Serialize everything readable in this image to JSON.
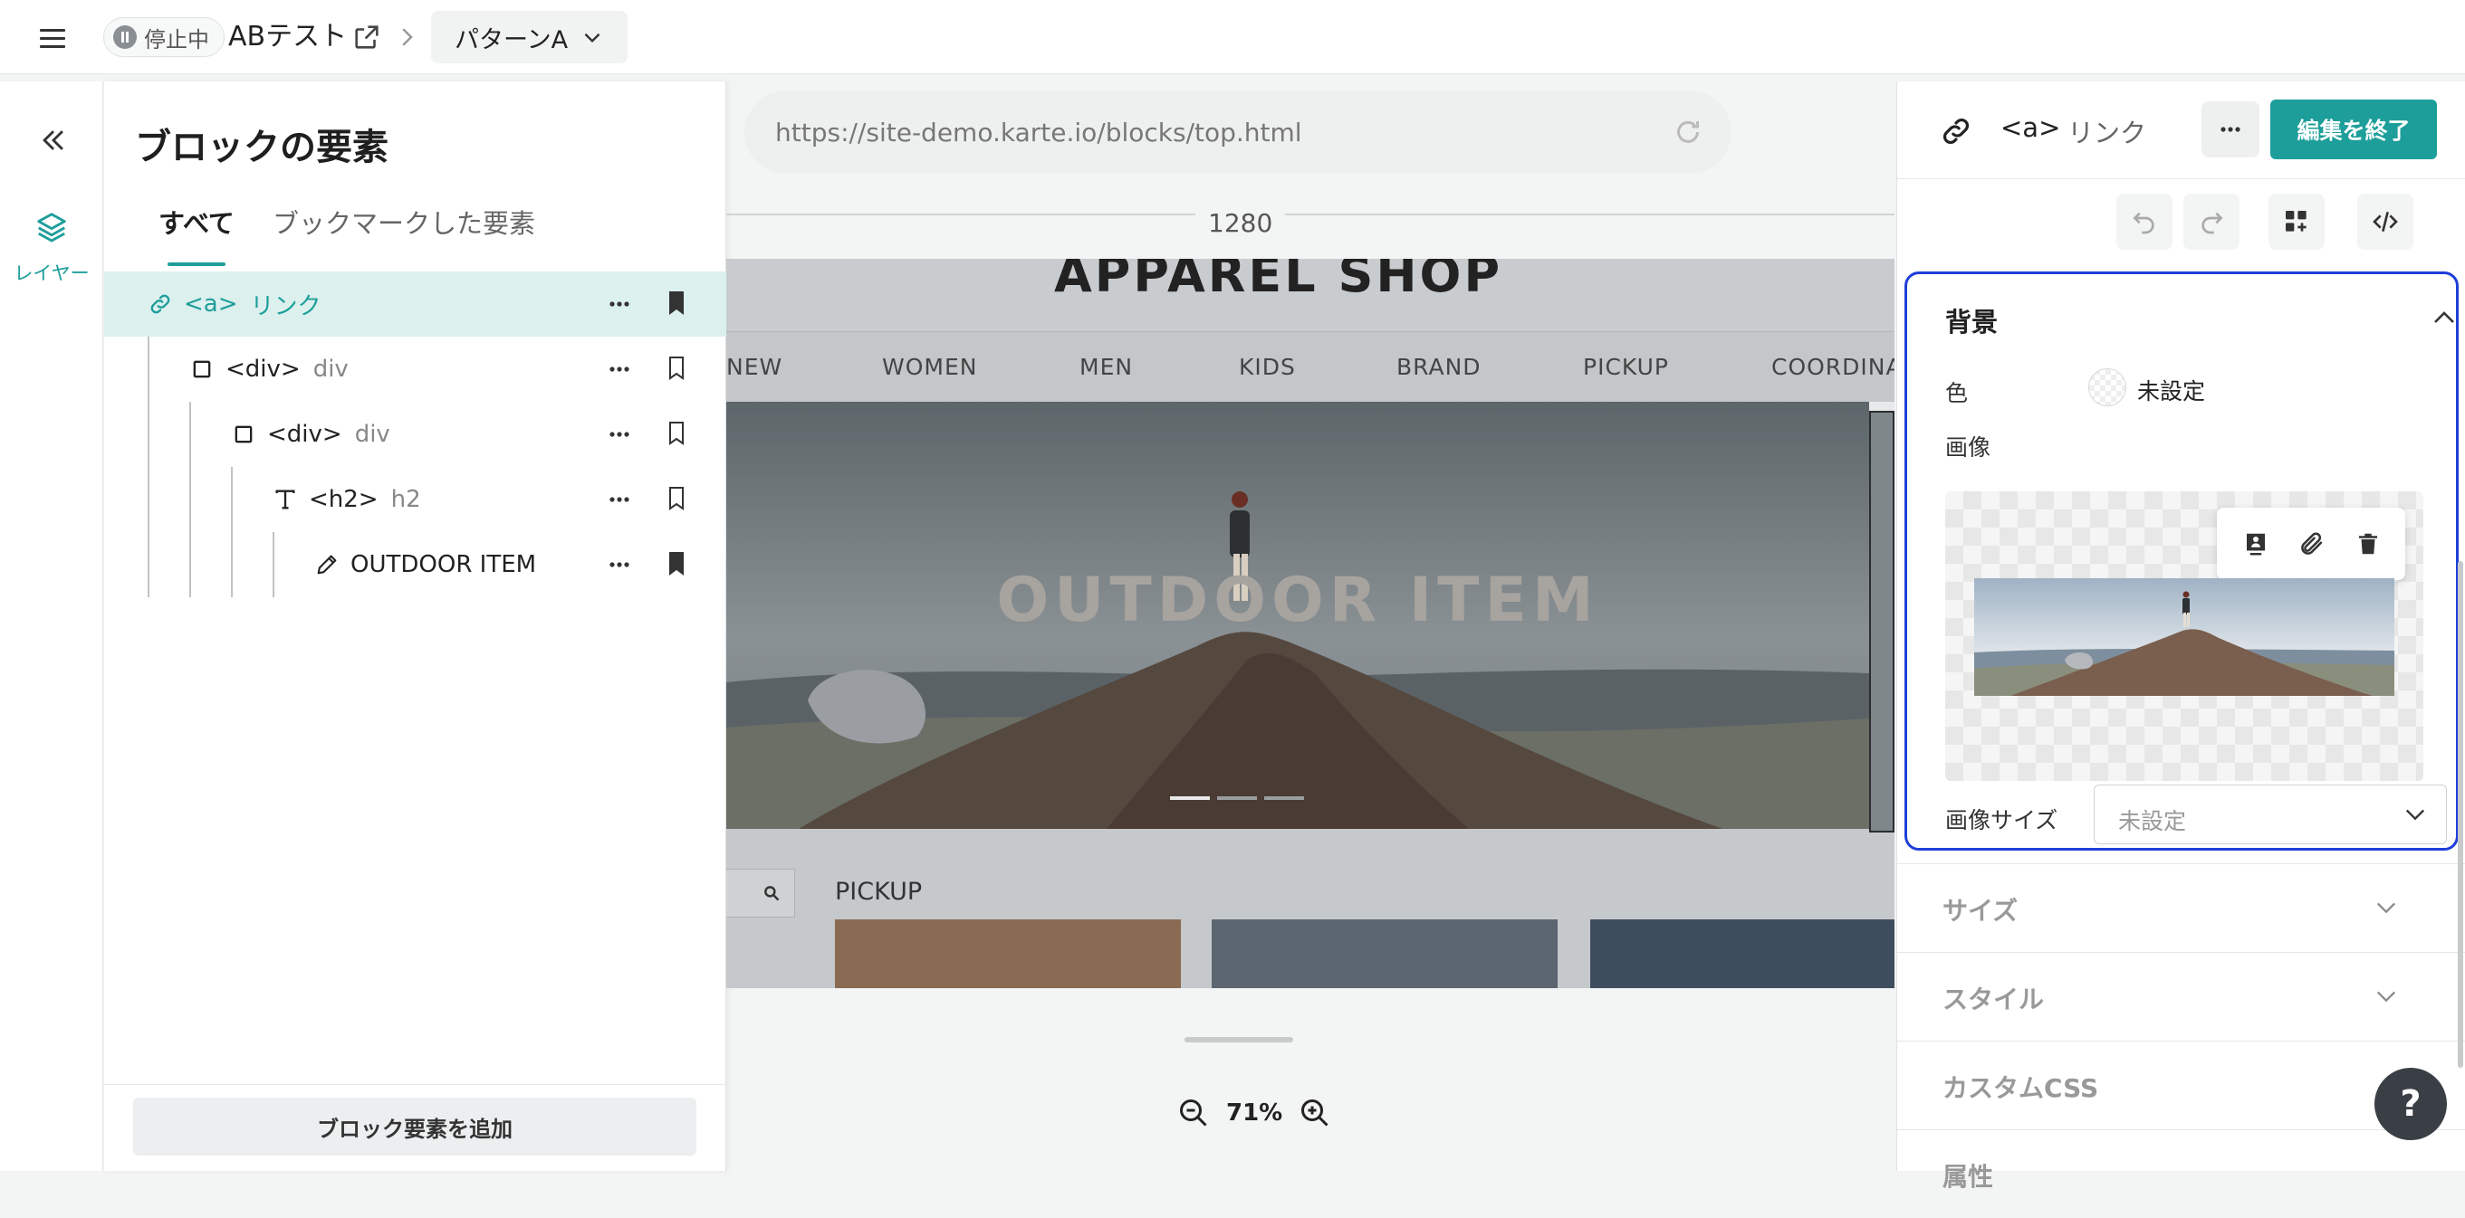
{
  "topbar": {
    "status": "停止中",
    "campaign_title": "ABテスト",
    "pattern": "パターンA"
  },
  "rail": {
    "layers_label": "レイヤー"
  },
  "panel": {
    "title": "ブロックの要素",
    "tabs": [
      "すべて",
      "ブックマークした要素"
    ],
    "tree": [
      {
        "tag": "<a>",
        "name": "リンク",
        "icon": "link-icon",
        "bookmarked": true,
        "selected": true
      },
      {
        "tag": "<div>",
        "name": "div",
        "icon": "square-icon",
        "bookmarked": false
      },
      {
        "tag": "<div>",
        "name": "div",
        "icon": "square-icon",
        "bookmarked": false
      },
      {
        "tag": "<h2>",
        "name": "h2",
        "icon": "text-icon",
        "bookmarked": false
      },
      {
        "tag": "OUTDOOR ITEM",
        "name": "",
        "icon": "pencil-icon",
        "bookmarked": true
      }
    ],
    "add_button": "ブロック要素を追加"
  },
  "canvas": {
    "url": "https://site-demo.karte.io/blocks/top.html",
    "width_label": "1280",
    "zoom": "71%",
    "site": {
      "title": "APPAREL SHOP",
      "nav": [
        "NEW",
        "WOMEN",
        "MEN",
        "KIDS",
        "BRAND",
        "PICKUP",
        "COORDINATE"
      ],
      "hero_text": "OUTDOOR ITEM",
      "pickup_label": "PICKUP"
    }
  },
  "inspector": {
    "element_tag": "<a>",
    "element_name": "リンク",
    "finish_button": "編集を終了",
    "background": {
      "title": "背景",
      "color_label": "色",
      "color_value": "未設定",
      "image_label": "画像",
      "image_size_label": "画像サイズ",
      "image_size_value": "未設定"
    },
    "sections": [
      "サイズ",
      "スタイル",
      "カスタムCSS",
      "属性"
    ]
  },
  "colors": {
    "accent": "#1d9e9a",
    "focus": "#1f3fd8"
  }
}
